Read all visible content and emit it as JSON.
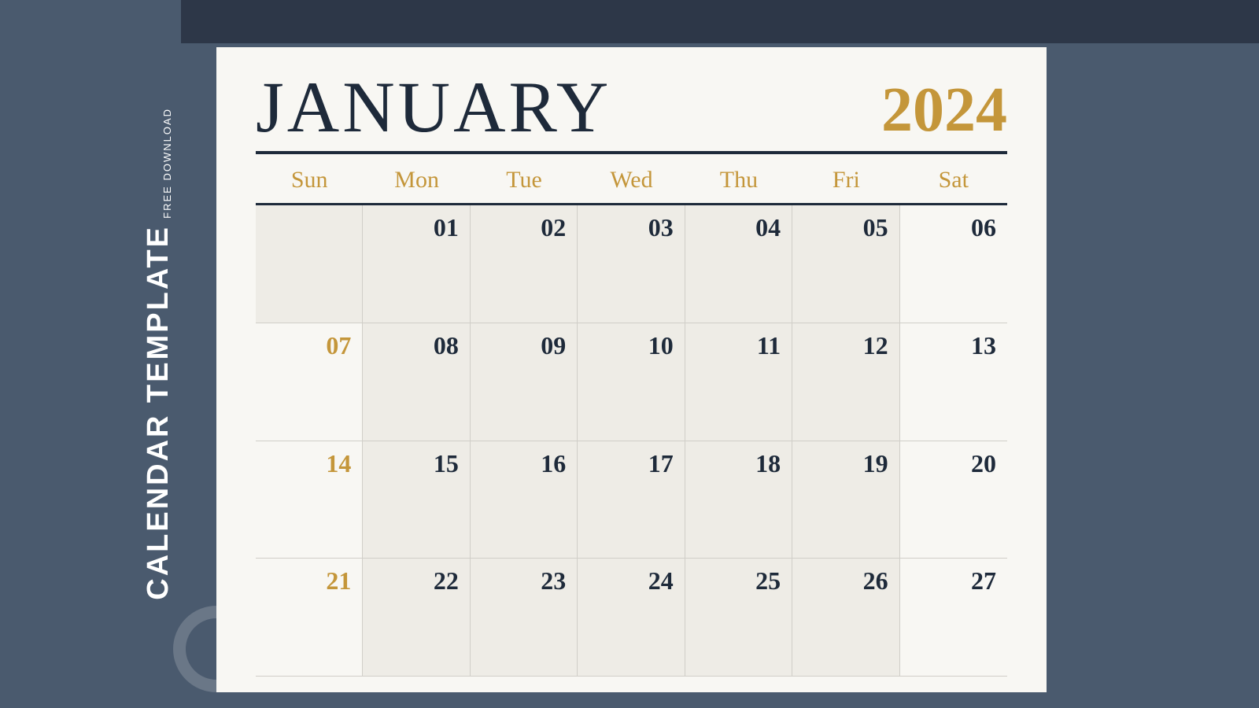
{
  "sidebar": {
    "free_download": "FREE DOWNLOAD",
    "calendar_template": "CALENDAR TEMPLATE"
  },
  "calendar": {
    "month": "JANUARY",
    "year": "2024",
    "day_headers": [
      "Sun",
      "Mon",
      "Tue",
      "Wed",
      "Thu",
      "Fri",
      "Sat"
    ],
    "weeks": [
      [
        {
          "num": "",
          "empty": true,
          "sunday": false,
          "shaded": true
        },
        {
          "num": "01",
          "empty": false,
          "sunday": false,
          "shaded": true
        },
        {
          "num": "02",
          "empty": false,
          "sunday": false,
          "shaded": true
        },
        {
          "num": "03",
          "empty": false,
          "sunday": false,
          "shaded": true
        },
        {
          "num": "04",
          "empty": false,
          "sunday": false,
          "shaded": true
        },
        {
          "num": "05",
          "empty": false,
          "sunday": false,
          "shaded": true
        },
        {
          "num": "06",
          "empty": false,
          "sunday": false,
          "shaded": false
        }
      ],
      [
        {
          "num": "07",
          "empty": false,
          "sunday": true,
          "shaded": false
        },
        {
          "num": "08",
          "empty": false,
          "sunday": false,
          "shaded": true
        },
        {
          "num": "09",
          "empty": false,
          "sunday": false,
          "shaded": true
        },
        {
          "num": "10",
          "empty": false,
          "sunday": false,
          "shaded": true
        },
        {
          "num": "11",
          "empty": false,
          "sunday": false,
          "shaded": true
        },
        {
          "num": "12",
          "empty": false,
          "sunday": false,
          "shaded": true
        },
        {
          "num": "13",
          "empty": false,
          "sunday": false,
          "shaded": false
        }
      ],
      [
        {
          "num": "14",
          "empty": false,
          "sunday": true,
          "shaded": false
        },
        {
          "num": "15",
          "empty": false,
          "sunday": false,
          "shaded": true
        },
        {
          "num": "16",
          "empty": false,
          "sunday": false,
          "shaded": true
        },
        {
          "num": "17",
          "empty": false,
          "sunday": false,
          "shaded": true
        },
        {
          "num": "18",
          "empty": false,
          "sunday": false,
          "shaded": true
        },
        {
          "num": "19",
          "empty": false,
          "sunday": false,
          "shaded": true
        },
        {
          "num": "20",
          "empty": false,
          "sunday": false,
          "shaded": false
        }
      ],
      [
        {
          "num": "21",
          "empty": false,
          "sunday": true,
          "shaded": false
        },
        {
          "num": "22",
          "empty": false,
          "sunday": false,
          "shaded": true
        },
        {
          "num": "23",
          "empty": false,
          "sunday": false,
          "shaded": true
        },
        {
          "num": "24",
          "empty": false,
          "sunday": false,
          "shaded": true
        },
        {
          "num": "25",
          "empty": false,
          "sunday": false,
          "shaded": true
        },
        {
          "num": "26",
          "empty": false,
          "sunday": false,
          "shaded": true
        },
        {
          "num": "27",
          "empty": false,
          "sunday": false,
          "shaded": false
        }
      ]
    ],
    "colors": {
      "accent_gold": "#c4963a",
      "navy": "#1e2a3a",
      "background": "#f8f7f3",
      "shaded_cell": "#eeece6",
      "slate": "#4a5a6e"
    }
  }
}
